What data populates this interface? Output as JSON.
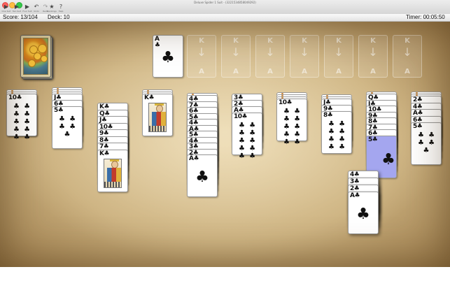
{
  "window": {
    "title": "Deluxe Spider 1 Suit - (3221534858049292)"
  },
  "toolbar": [
    {
      "icon": "play-icon",
      "label": "One Suit"
    },
    {
      "icon": "play-icon",
      "label": "Two Suit"
    },
    {
      "icon": "play-icon",
      "label": "Four Suit"
    },
    {
      "icon": "undo-icon",
      "label": "Undo"
    },
    {
      "icon": "redo-icon",
      "label": "Redo"
    },
    {
      "icon": "star-icon",
      "label": "Rankings"
    },
    {
      "icon": "help-icon",
      "label": "Help"
    }
  ],
  "status": {
    "score": "Score:  13/104",
    "deck": "Deck:  10",
    "timer": "Timer:  00:05:50"
  },
  "foundations": [
    {
      "top": "A",
      "suit": "♣"
    },
    {
      "k": "K",
      "a": "A"
    },
    {
      "k": "K",
      "a": "A"
    },
    {
      "k": "K",
      "a": "A"
    },
    {
      "k": "K",
      "a": "A"
    },
    {
      "k": "K",
      "a": "A"
    },
    {
      "k": "K",
      "a": "A"
    },
    {
      "k": "K",
      "a": "A"
    }
  ],
  "tableau": [
    {
      "cards": [
        "J",
        "10"
      ],
      "face_last": false
    },
    {
      "cards": [
        "J",
        "6",
        "5"
      ],
      "face_last": false
    },
    {
      "cards": [
        "K",
        "Q",
        "J",
        "10",
        "9",
        "8",
        "7",
        "K"
      ],
      "face_last": true
    },
    {
      "cards": [
        "K"
      ],
      "face_last": true
    },
    {
      "cards": [
        "4",
        "7",
        "6",
        "5",
        "4",
        "A",
        "5",
        "4",
        "3",
        "2",
        "A"
      ],
      "face_last": false
    },
    {
      "cards": [
        "3",
        "2",
        "A",
        "10"
      ],
      "face_last": false
    },
    {
      "cards": [
        "10"
      ],
      "face_last": false
    },
    {
      "cards": [
        "J",
        "9",
        "8"
      ],
      "face_last": false
    },
    {
      "cards": [
        "Q",
        "J",
        "10",
        "9",
        "8",
        "7",
        "6",
        "5"
      ],
      "face_last": false,
      "highlight_last": true
    },
    {
      "cards": [
        "2",
        "4",
        "A",
        "6",
        "5"
      ],
      "face_last": false
    }
  ],
  "drag_stack": [
    "4",
    "3",
    "2",
    "A"
  ],
  "suit": "♣"
}
